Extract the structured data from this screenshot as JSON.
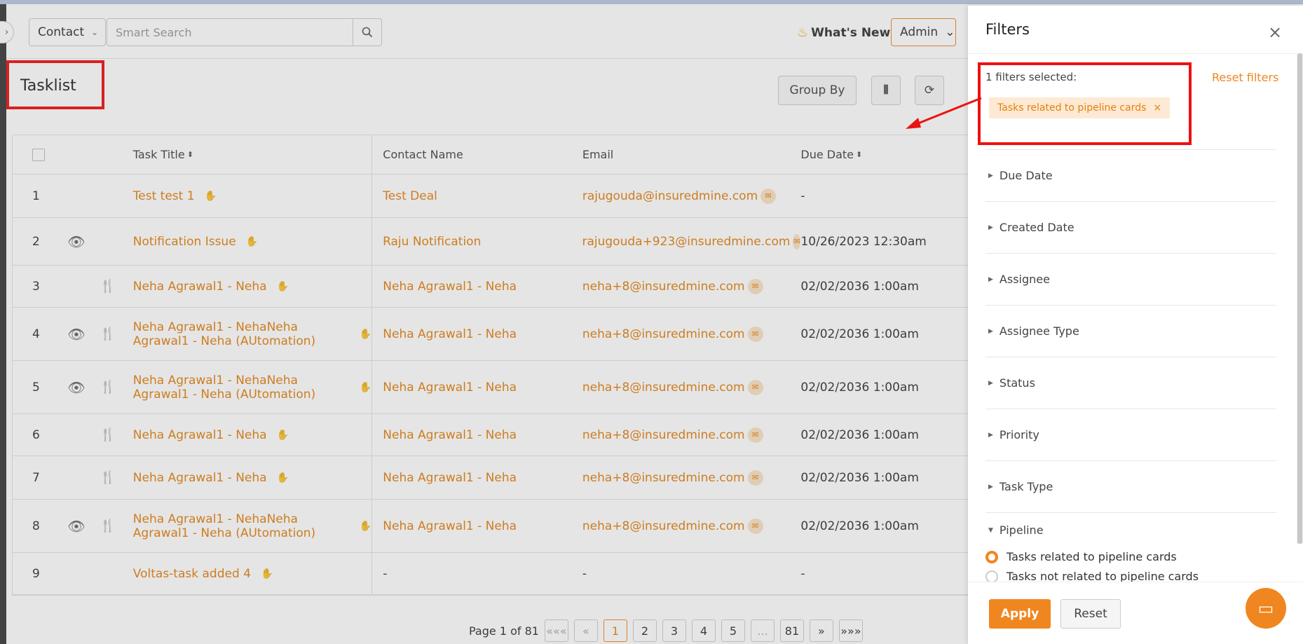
{
  "header": {
    "module_select": "Contact",
    "search_placeholder": "Smart Search",
    "whats_new": "What's New",
    "role_select": "Admin"
  },
  "page": {
    "title": "Tasklist",
    "group_by": "Group By"
  },
  "table": {
    "columns": {
      "task_title": "Task Title",
      "contact_name": "Contact Name",
      "email": "Email",
      "due_date": "Due Date"
    },
    "rows": [
      {
        "idx": "1",
        "view": false,
        "fork": false,
        "title": "Test test 1",
        "contact": "Test Deal",
        "email": "rajugouda@insuredmine.com",
        "due": "-"
      },
      {
        "idx": "2",
        "view": true,
        "fork": false,
        "title": "Notification Issue",
        "contact": "Raju Notification",
        "email": "rajugouda+923@insuredmine.com",
        "due": "10/26/2023 12:30am"
      },
      {
        "idx": "3",
        "view": false,
        "fork": true,
        "title": "Neha Agrawal1 - Neha",
        "contact": "Neha Agrawal1 - Neha",
        "email": "neha+8@insuredmine.com",
        "due": "02/02/2036 1:00am"
      },
      {
        "idx": "4",
        "view": true,
        "fork": true,
        "title": "Neha Agrawal1 - NehaNeha Agrawal1 - Neha (AUtomation)",
        "contact": "Neha Agrawal1 - Neha",
        "email": "neha+8@insuredmine.com",
        "due": "02/02/2036 1:00am"
      },
      {
        "idx": "5",
        "view": true,
        "fork": true,
        "title": "Neha Agrawal1 - NehaNeha Agrawal1 - Neha (AUtomation)",
        "contact": "Neha Agrawal1 - Neha",
        "email": "neha+8@insuredmine.com",
        "due": "02/02/2036 1:00am"
      },
      {
        "idx": "6",
        "view": false,
        "fork": true,
        "title": "Neha Agrawal1 - Neha",
        "contact": "Neha Agrawal1 - Neha",
        "email": "neha+8@insuredmine.com",
        "due": "02/02/2036 1:00am"
      },
      {
        "idx": "7",
        "view": false,
        "fork": true,
        "title": "Neha Agrawal1 - Neha",
        "contact": "Neha Agrawal1 - Neha",
        "email": "neha+8@insuredmine.com",
        "due": "02/02/2036 1:00am"
      },
      {
        "idx": "8",
        "view": true,
        "fork": true,
        "title": "Neha Agrawal1 - NehaNeha Agrawal1 - Neha (AUtomation)",
        "contact": "Neha Agrawal1 - Neha",
        "email": "neha+8@insuredmine.com",
        "due": "02/02/2036 1:00am"
      },
      {
        "idx": "9",
        "view": false,
        "fork": false,
        "title": "Voltas-task added 4",
        "contact": "-",
        "email": "-",
        "due": "-"
      }
    ]
  },
  "pagination": {
    "label": "Page 1 of 81",
    "first": "«««",
    "prev": "«",
    "pages": [
      "1",
      "2",
      "3",
      "4",
      "5",
      "...",
      "81"
    ],
    "next": "»",
    "last": "»»»"
  },
  "filters": {
    "title": "Filters",
    "selected_label": "1 filters selected:",
    "reset_filters": "Reset filters",
    "chip": "Tasks related to pipeline cards",
    "sections": [
      "Due Date",
      "Created Date",
      "Assignee",
      "Assignee Type",
      "Status",
      "Priority",
      "Task Type",
      "Pipeline"
    ],
    "pipeline_options": [
      {
        "label": "Tasks related to pipeline cards",
        "selected": true
      },
      {
        "label": "Tasks not related to pipeline cards",
        "selected": false
      }
    ],
    "apply": "Apply",
    "reset": "Reset"
  },
  "colors": {
    "accent": "#f0861f",
    "highlight_box": "#ee1111"
  }
}
